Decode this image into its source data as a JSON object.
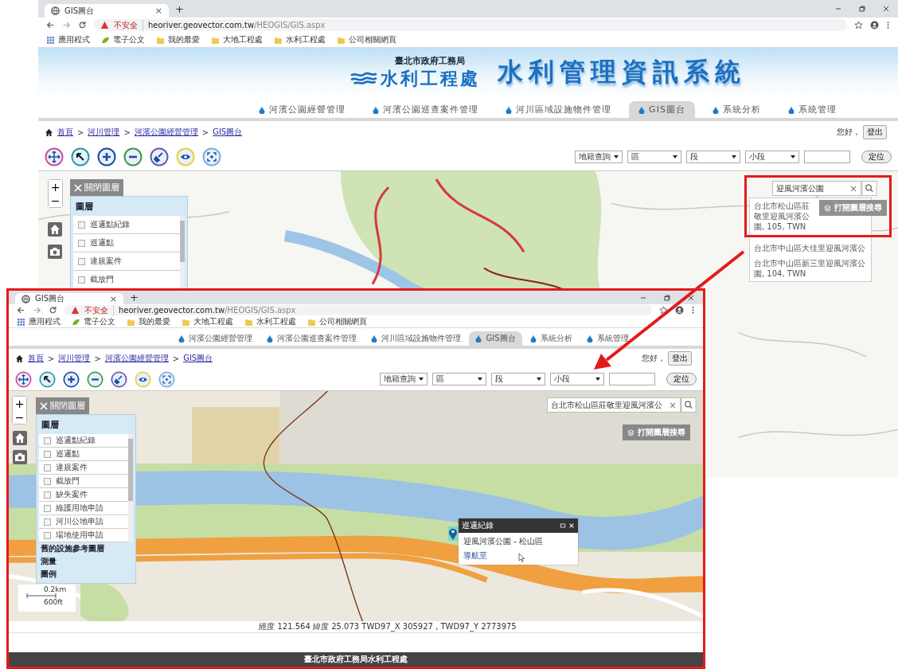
{
  "windows": [
    {
      "kind": "back",
      "browser": {
        "tab": "GIS圖台",
        "tab_close": "×",
        "new_tab": "+",
        "security": "不安全",
        "url_host": "heoriver.geovector.com.tw",
        "url_path": "/HEOGIS/GIS.aspx",
        "bookmarks": [
          {
            "kind": "apps",
            "label": "應用程式"
          },
          {
            "kind": "leaf",
            "label": "電子公文"
          },
          {
            "kind": "folder",
            "label": "我的最愛"
          },
          {
            "kind": "folder",
            "label": "大地工程處"
          },
          {
            "kind": "folder",
            "label": "水利工程處"
          },
          {
            "kind": "folder",
            "label": "公司相關網頁"
          }
        ]
      },
      "banner": {
        "agency": "臺北市政府工務局",
        "office": "水利工程處",
        "title": "水利管理資訊系統"
      },
      "nav": [
        {
          "label": "河濱公園經營管理",
          "selected": false
        },
        {
          "label": "河濱公園巡查案件管理",
          "selected": false
        },
        {
          "label": "河川區域設施物件管理",
          "selected": false
        },
        {
          "label": "GIS圖台",
          "selected": true
        },
        {
          "label": "系統分析",
          "selected": false
        },
        {
          "label": "系統管理",
          "selected": false
        }
      ],
      "breadcrumb": {
        "separator": ">",
        "items": [
          "首頁",
          "河川管理",
          "河濱公園經營管理",
          "GIS圖台"
        ]
      },
      "greeting": "您好，",
      "logout": "登出",
      "filters": {
        "mode": "地籍查詢",
        "selects": [
          "區",
          "段",
          "小段"
        ],
        "button": "定位"
      },
      "map_controls": {
        "zoom_in": "+",
        "zoom_out": "−"
      },
      "layer_panel": {
        "close": "關閉圖層",
        "title": "圖層",
        "layers": [
          {
            "label": "巡邏點紀錄",
            "checked": false
          },
          {
            "label": "巡邏點",
            "checked": false
          },
          {
            "label": "違規案件",
            "checked": false
          },
          {
            "label": "截放門",
            "checked": false
          }
        ]
      },
      "search": {
        "value": "迎風河濱公園",
        "clear": "×",
        "layer_search": "打開圖層搜尋",
        "results": [
          "台北市松山區莊敬里迎風河濱公園, 105, TWN",
          "台北市中山區大佳里迎風河濱公",
          "台北市中山區新三里迎風河濱公園, 104, TWN"
        ]
      }
    },
    {
      "kind": "front",
      "browser": {
        "tab": "GIS圖台",
        "tab_close": "×",
        "new_tab": "+",
        "security": "不安全",
        "url_host": "heoriver.geovector.com.tw",
        "url_path": "/HEOGIS/GIS.aspx",
        "bookmarks": [
          {
            "kind": "apps",
            "label": "應用程式"
          },
          {
            "kind": "leaf",
            "label": "電子公文"
          },
          {
            "kind": "folder",
            "label": "我的最愛"
          },
          {
            "kind": "folder",
            "label": "大地工程處"
          },
          {
            "kind": "folder",
            "label": "水利工程處"
          },
          {
            "kind": "folder",
            "label": "公司相關網頁"
          }
        ]
      },
      "nav": [
        {
          "label": "河濱公園經營管理",
          "selected": false
        },
        {
          "label": "河濱公園巡查案件管理",
          "selected": false
        },
        {
          "label": "河川區域設施物件管理",
          "selected": false
        },
        {
          "label": "GIS圖台",
          "selected": true
        },
        {
          "label": "系統分析",
          "selected": false
        },
        {
          "label": "系統管理",
          "selected": false
        }
      ],
      "breadcrumb": {
        "separator": ">",
        "items": [
          "首頁",
          "河川管理",
          "河濱公園經營管理",
          "GIS圖台"
        ]
      },
      "greeting": "您好，",
      "logout": "登出",
      "filters": {
        "mode": "地籍查詢",
        "selects": [
          "區",
          "段",
          "小段"
        ],
        "button": "定位"
      },
      "map_controls": {
        "zoom_in": "+",
        "zoom_out": "−"
      },
      "layer_panel": {
        "close": "關閉圖層",
        "title": "圖層",
        "layers": [
          {
            "label": "巡邏點紀錄",
            "checked": false
          },
          {
            "label": "巡邏點",
            "checked": false
          },
          {
            "label": "違規案件",
            "checked": false
          },
          {
            "label": "截放門",
            "checked": false
          },
          {
            "label": "缺失案件",
            "checked": false
          },
          {
            "label": "維護用地申請",
            "checked": false
          },
          {
            "label": "河川公地申請",
            "checked": false
          },
          {
            "label": "場地使用申請",
            "checked": false
          }
        ],
        "sections": [
          "舊的設施參考圖層",
          "測量",
          "圖例"
        ]
      },
      "search": {
        "value": "台北市松山區莊敬里迎風河濱公",
        "clear": "×",
        "layer_search": "打開圖層搜尋"
      },
      "popup": {
        "title": "巡邏紀錄",
        "body": "迎風河濱公園 - 松山區",
        "link": "導航至"
      },
      "scale": {
        "metric": "0.2km",
        "imperial": "600ft"
      },
      "coords": "經度 121.564  緯度 25.073   TWD97_X 305927 , TWD97_Y 2773975",
      "footer": "臺北市政府工務局水利工程處"
    }
  ]
}
